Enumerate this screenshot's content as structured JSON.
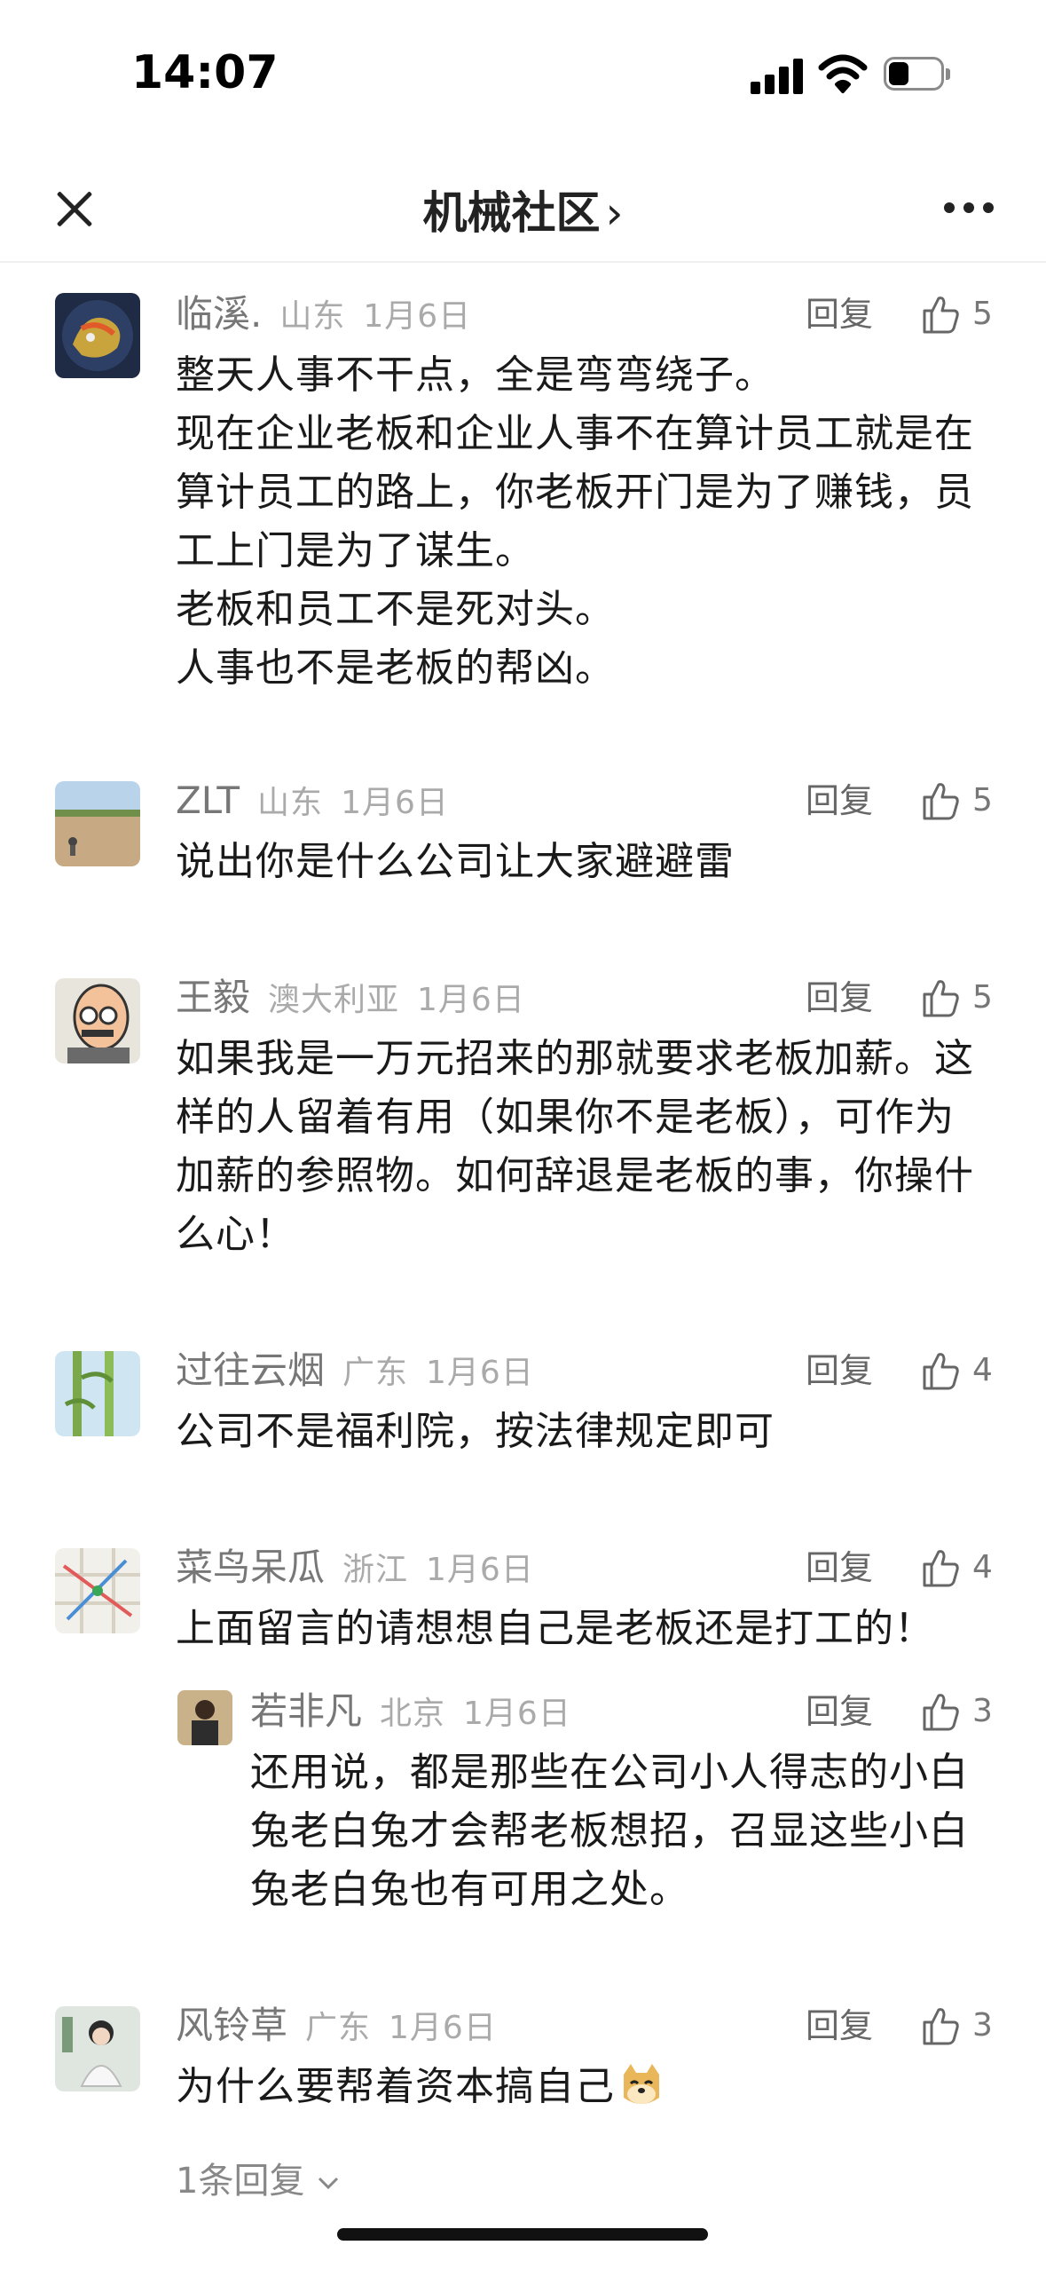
{
  "status_bar": {
    "time": "14:07"
  },
  "nav": {
    "title": "机械社区",
    "chevron": "›"
  },
  "reply_label": "回复",
  "comments": [
    {
      "author": "临溪.",
      "location": "山东",
      "date": "1月6日",
      "likes": "5",
      "lines": [
        "整天人事不干点，全是弯弯绕子。",
        "现在企业老板和企业人事不在算计员工就是在",
        "算计员工的路上，你老板开门是为了赚钱，员",
        "工上门是为了谋生。",
        "老板和员工不是死对头。",
        "人事也不是老板的帮凶。"
      ]
    },
    {
      "author": "ZLT",
      "location": "山东",
      "date": "1月6日",
      "likes": "5",
      "lines": [
        "说出你是什么公司让大家避避雷"
      ]
    },
    {
      "author": "王毅",
      "location": "澳大利亚",
      "date": "1月6日",
      "likes": "5",
      "lines": [
        "如果我是一万元招来的那就要求老板加薪。这",
        "样的人留着有用（如果你不是老板），可作为",
        "加薪的参照物。如何辞退是老板的事，你操什",
        "么心！"
      ]
    },
    {
      "author": "过往云烟",
      "location": "广东",
      "date": "1月6日",
      "likes": "4",
      "lines": [
        "公司不是福利院，按法律规定即可"
      ]
    },
    {
      "author": "菜鸟呆瓜",
      "location": "浙江",
      "date": "1月6日",
      "likes": "4",
      "lines": [
        "上面留言的请想想自己是老板还是打工的！"
      ]
    },
    {
      "author": "若非凡",
      "location": "北京",
      "date": "1月6日",
      "likes": "3",
      "lines": [
        "还用说，都是那些在公司小人得志的小白",
        "兔老白兔才会帮老板想招，召显这些小白",
        "兔老白兔也有可用之处。"
      ]
    },
    {
      "author": "风铃草",
      "location": "广东",
      "date": "1月6日",
      "likes": "3",
      "lines": [
        "为什么要帮着资本搞自己"
      ],
      "emoji": "doge-emoji",
      "expand_label": "1条回复"
    }
  ]
}
